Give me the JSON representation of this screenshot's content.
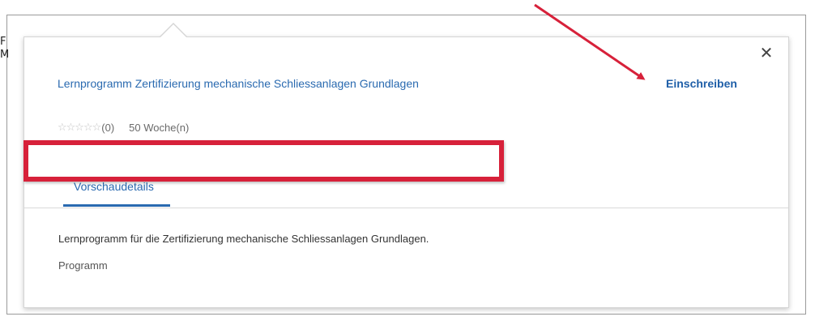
{
  "background": {
    "line1": "F",
    "line2": "M"
  },
  "popover": {
    "close_symbol": "✕",
    "course_title": "Lernprogramm Zertifizierung mechanische Schliessanlagen Grundlagen",
    "enroll_label": "Einschreiben",
    "rating_stars": "☆☆☆☆☆",
    "rating_count": "(0)",
    "duration": "50 Woche(n)",
    "tab_label": "Vorschaudetails",
    "description": "Lernprogramm für die Zertifizierung mechanische Schliessanlagen Grundlagen.",
    "type": "Programm"
  },
  "colors": {
    "link": "#2a6ab0",
    "annotation_red": "#d7213a"
  }
}
